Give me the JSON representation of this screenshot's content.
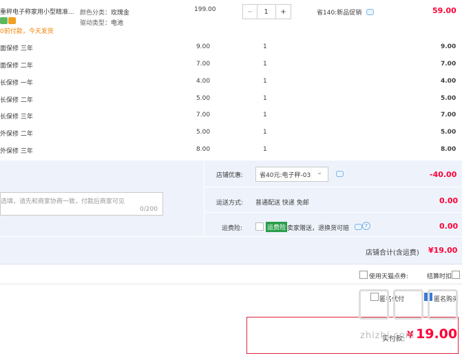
{
  "product": {
    "title": "重秤电子称家用小型精准...",
    "tags_text": "0前付款，今天发货",
    "color_label": "颜色分类：",
    "color_value": "玫瑰金",
    "drive_label": "驱动类型：",
    "drive_value": "电池",
    "price": "199.00",
    "qty_minus": "−",
    "qty_value": "1",
    "qty_plus": "+",
    "promo": "省140:新品促销",
    "subtotal": "59.00"
  },
  "services": [
    {
      "name": "面保修 三年",
      "price": "9.00",
      "qty": "1",
      "total": "9.00"
    },
    {
      "name": "面保修 二年",
      "price": "7.00",
      "qty": "1",
      "total": "7.00"
    },
    {
      "name": "长保修 一年",
      "price": "4.00",
      "qty": "1",
      "total": "4.00"
    },
    {
      "name": "长保修 二年",
      "price": "5.00",
      "qty": "1",
      "total": "5.00"
    },
    {
      "name": "长保修 三年",
      "price": "7.00",
      "qty": "1",
      "total": "7.00"
    },
    {
      "name": "外保修 二年",
      "price": "5.00",
      "qty": "1",
      "total": "5.00"
    },
    {
      "name": "外保修 三年",
      "price": "8.00",
      "qty": "1",
      "total": "8.00"
    }
  ],
  "shop": {
    "coupon_label": "店铺优惠:",
    "coupon_value": "省40元:电子秤-03",
    "coupon_amount": "-40.00",
    "message_placeholder": "选填，请先和商家协商一致，付款后商家可见",
    "message_counter": "0/200",
    "shipping_label": "运送方式:",
    "shipping_value": "普通配送 快递 免邮",
    "shipping_amount": "0.00",
    "insurance_label": "运费险:",
    "insurance_badge": "运费险",
    "insurance_text": "卖家赠送，退换货可赔",
    "insurance_amount": "0.00",
    "total_label": "店铺合计(含运费)",
    "total_value": "¥19.00"
  },
  "points": {
    "label": "使用天猫点券:",
    "deduct": "结算时扣除"
  },
  "options": {
    "anon_label": "匿名代付",
    "anon2_label": "匿名购买"
  },
  "payment": {
    "label": "实付款:",
    "currency": "¥",
    "amount": "19.00"
  },
  "watermark": {
    "text": "zhizhi.com"
  }
}
